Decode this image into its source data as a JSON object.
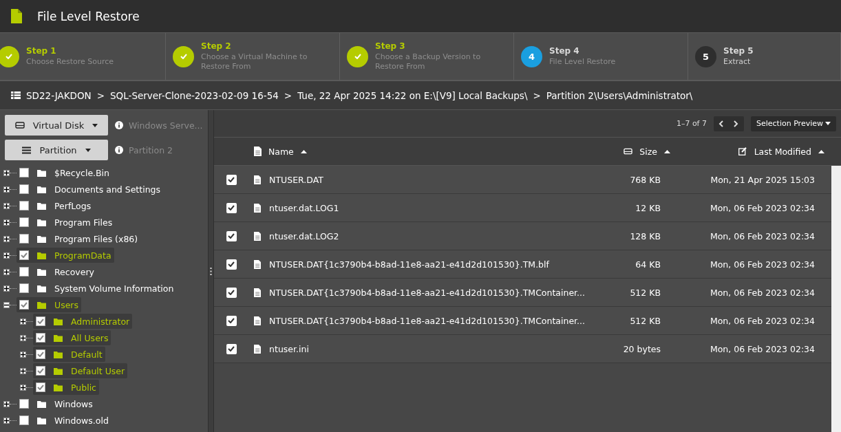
{
  "window": {
    "title": "File Level Restore"
  },
  "steps": [
    {
      "label": "Step 1",
      "description": "Choose Restore Source",
      "completed": true,
      "selected": false
    },
    {
      "label": "Step 2",
      "description": "Choose a Virtual Machine to Restore From",
      "completed": true,
      "selected": false
    },
    {
      "label": "Step 3",
      "description": "Choose a Backup Version to Restore From",
      "completed": true,
      "selected": false
    },
    {
      "label": "Step 4",
      "number": "4",
      "description": "File Level Restore",
      "completed": false,
      "selected": true
    },
    {
      "label": "Step 5",
      "number": "5",
      "description": "Extract",
      "completed": false,
      "selected": false
    }
  ],
  "breadcrumb": [
    "SD22-JAKDON",
    "SQL-Server-Clone-2023-02-09 16-54",
    "Tue, 22 Apr 2025 14:22 on E:\\[V9] Local Backups\\",
    "Partition 2\\Users\\Administrator\\"
  ],
  "breadcrumb_separator": ">",
  "selectors": [
    {
      "kind": "disk",
      "label": "Virtual Disk",
      "info": "Windows Serve..."
    },
    {
      "kind": "partition",
      "label": "Partition",
      "info": "Partition 2"
    }
  ],
  "tree": [
    {
      "name": "$Recycle.Bin",
      "checked": false,
      "expanded": false
    },
    {
      "name": "Documents and Settings",
      "checked": false,
      "expanded": false
    },
    {
      "name": "PerfLogs",
      "checked": false,
      "expanded": false
    },
    {
      "name": "Program Files",
      "checked": false,
      "expanded": false
    },
    {
      "name": "Program Files (x86)",
      "checked": false,
      "expanded": false
    },
    {
      "name": "ProgramData",
      "checked": true,
      "expanded": false
    },
    {
      "name": "Recovery",
      "checked": false,
      "expanded": false
    },
    {
      "name": "System Volume Information",
      "checked": false,
      "expanded": false
    },
    {
      "name": "Users",
      "checked": true,
      "expanded": true,
      "children": [
        {
          "name": "Administrator",
          "checked": true,
          "expanded": false
        },
        {
          "name": "All Users",
          "checked": true,
          "expanded": false
        },
        {
          "name": "Default",
          "checked": true,
          "expanded": false
        },
        {
          "name": "Default User",
          "checked": true,
          "expanded": false
        },
        {
          "name": "Public",
          "checked": true,
          "expanded": false
        }
      ]
    },
    {
      "name": "Windows",
      "checked": false,
      "expanded": false
    },
    {
      "name": "Windows.old",
      "checked": false,
      "expanded": false
    }
  ],
  "pagination": {
    "range": "1–7 of 7"
  },
  "preview_button": "Selection Preview",
  "table": {
    "columns": [
      {
        "label": "Name",
        "kind": "name"
      },
      {
        "label": "Size",
        "kind": "size"
      },
      {
        "label": "Last Modified",
        "kind": "modified"
      }
    ],
    "rows": [
      {
        "name": "NTUSER.DAT",
        "size": "768 KB",
        "modified": "Mon, 21 Apr 2025 15:03",
        "checked": true
      },
      {
        "name": "ntuser.dat.LOG1",
        "size": "12 KB",
        "modified": "Mon, 06 Feb 2023 02:34",
        "checked": true
      },
      {
        "name": "ntuser.dat.LOG2",
        "size": "128 KB",
        "modified": "Mon, 06 Feb 2023 02:34",
        "checked": true
      },
      {
        "name": "NTUSER.DAT{1c3790b4-b8ad-11e8-aa21-e41d2d101530}.TM.blf",
        "size": "64 KB",
        "modified": "Mon, 06 Feb 2023 02:34",
        "checked": true
      },
      {
        "name": "NTUSER.DAT{1c3790b4-b8ad-11e8-aa21-e41d2d101530}.TMContainer...",
        "size": "512 KB",
        "modified": "Mon, 06 Feb 2023 02:34",
        "checked": true
      },
      {
        "name": "NTUSER.DAT{1c3790b4-b8ad-11e8-aa21-e41d2d101530}.TMContainer...",
        "size": "512 KB",
        "modified": "Mon, 06 Feb 2023 02:34",
        "checked": true
      },
      {
        "name": "ntuser.ini",
        "size": "20 bytes",
        "modified": "Mon, 06 Feb 2023 02:34",
        "checked": true
      }
    ]
  }
}
